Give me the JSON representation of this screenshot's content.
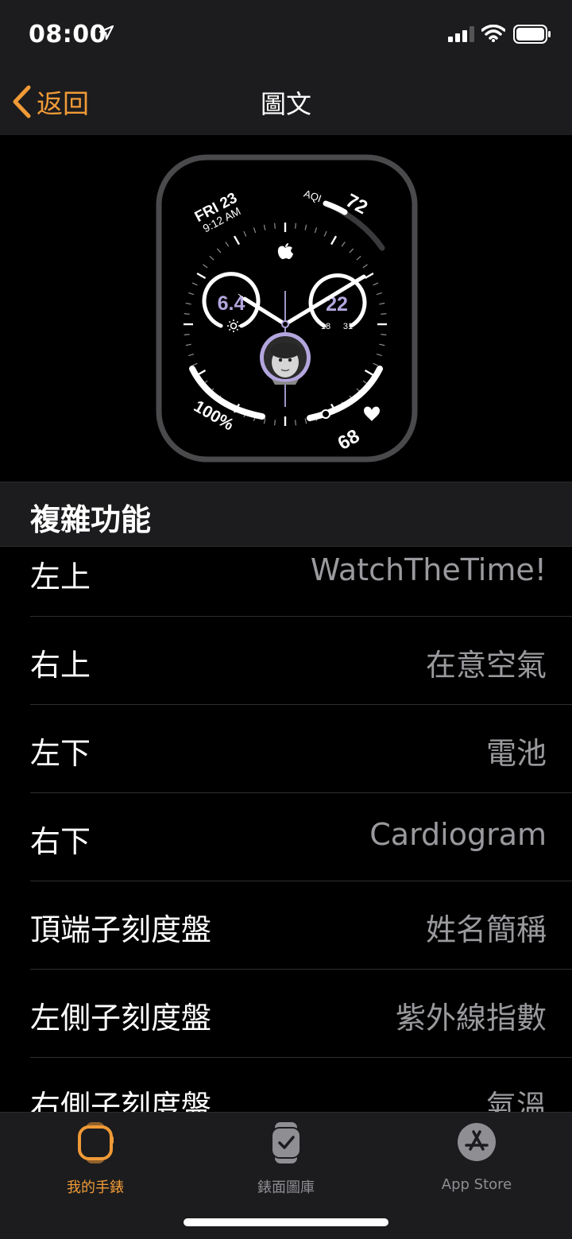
{
  "status": {
    "time": "08:00"
  },
  "nav": {
    "back_label": "返回",
    "title": "圖文"
  },
  "watch_face": {
    "date_line1": "FRI 23",
    "date_line2": "9:12 AM",
    "aqi_label": "AQI",
    "aqi_value": "72",
    "uv_value": "6.4",
    "temp_value": "22",
    "temp_low": "18",
    "temp_high": "31",
    "battery_value": "100%",
    "heart_value": "68"
  },
  "section": {
    "title": "複雜功能"
  },
  "rows": [
    {
      "label": "左上",
      "value": "WatchTheTime!"
    },
    {
      "label": "右上",
      "value": "在意空氣"
    },
    {
      "label": "左下",
      "value": "電池"
    },
    {
      "label": "右下",
      "value": "Cardiogram"
    },
    {
      "label": "頂端子刻度盤",
      "value": "姓名簡稱"
    },
    {
      "label": "左側子刻度盤",
      "value": "紫外線指數"
    },
    {
      "label": "右側子刻度盤",
      "value": "氣溫"
    }
  ],
  "tabs": [
    {
      "label": "我的手錶",
      "icon": "watch-icon",
      "active": true
    },
    {
      "label": "錶面圖庫",
      "icon": "face-gallery-icon",
      "active": false
    },
    {
      "label": "App Store",
      "icon": "app-store-icon",
      "active": false
    }
  ],
  "colors": {
    "accent": "#f09a37",
    "secondary_text": "#9a9a9e",
    "complication": "#b3a6de"
  }
}
